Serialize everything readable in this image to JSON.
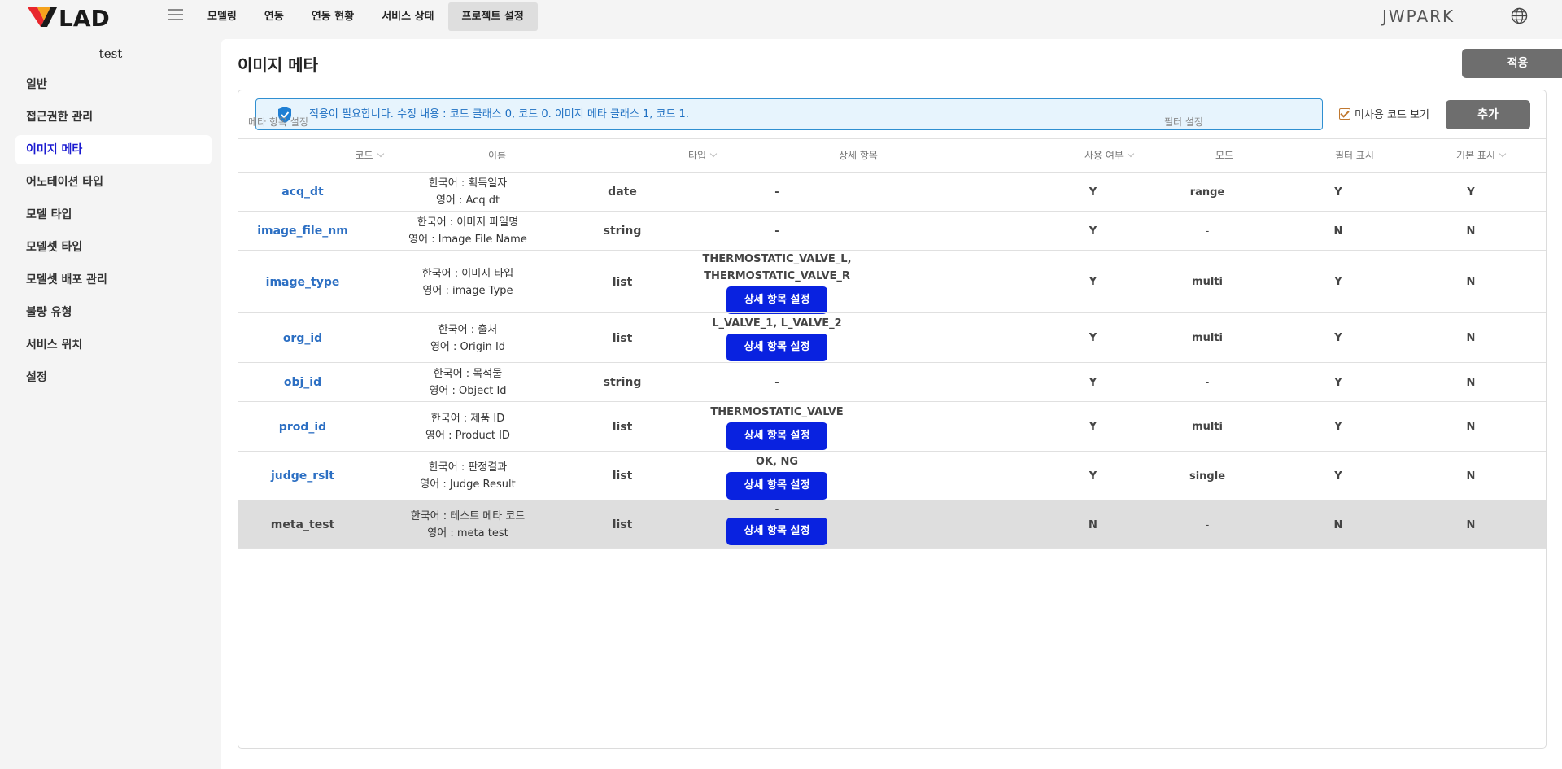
{
  "topbar": {
    "logo_text": "VLAD",
    "nav": [
      "모델링",
      "연동",
      "연동 현황",
      "서비스 상태",
      "프로젝트 설정"
    ],
    "active_nav": "프로젝트 설정",
    "user": "JWPARK"
  },
  "sidebar": {
    "project": "test",
    "items": [
      "일반",
      "접근권한 관리",
      "이미지 메타",
      "어노테이션 타입",
      "모델 타입",
      "모델셋 타입",
      "모델셋 배포 관리",
      "불량 유형",
      "서비스 위치",
      "설정"
    ],
    "active": "이미지 메타"
  },
  "page": {
    "title": "이미지 메타",
    "apply_label": "적용",
    "add_label": "추가",
    "notice": "적용이 필요합니다. 수정 내용 : 코드 클래스 0, 코드 0. 이미지 메타 클래스 1, 코드 1.",
    "unused_label": "미사용 코드 보기",
    "unused_checked": true
  },
  "table": {
    "group_meta": "메타 항목 설정",
    "group_filter": "필터 설정",
    "headers": {
      "code": "코드",
      "name": "이름",
      "type": "타입",
      "detail": "상세 항목",
      "use": "사용 여부",
      "mode": "모드",
      "filter_show": "필터 표시",
      "default_show": "기본 표시"
    },
    "detail_button_label": "상세 항목 설정",
    "rows": [
      {
        "code": "acq_dt",
        "name_ko": "한국어 : 획득일자",
        "name_en": "영어 : Acq dt",
        "type": "date",
        "detail": [
          "-"
        ],
        "has_button": false,
        "use": "Y",
        "mode": "range",
        "filter_show": "Y",
        "default_show": "Y",
        "disabled": false
      },
      {
        "code": "image_file_nm",
        "name_ko": "한국어 : 이미지 파일명",
        "name_en": "영어 : Image File Name",
        "type": "string",
        "detail": [
          "-"
        ],
        "has_button": false,
        "use": "Y",
        "mode": "-",
        "filter_show": "N",
        "default_show": "N",
        "disabled": false
      },
      {
        "code": "image_type",
        "name_ko": "한국어 : 이미지 타입",
        "name_en": "영어 : image Type",
        "type": "list",
        "detail": [
          "THERMOSTATIC_VALVE_L,",
          "THERMOSTATIC_VALVE_R"
        ],
        "has_button": true,
        "use": "Y",
        "mode": "multi",
        "filter_show": "Y",
        "default_show": "N",
        "disabled": false
      },
      {
        "code": "org_id",
        "name_ko": "한국어 : 출처",
        "name_en": "영어 : Origin Id",
        "type": "list",
        "detail": [
          "L_VALVE_1, L_VALVE_2"
        ],
        "has_button": true,
        "use": "Y",
        "mode": "multi",
        "filter_show": "Y",
        "default_show": "N",
        "disabled": false
      },
      {
        "code": "obj_id",
        "name_ko": "한국어 : 목적물",
        "name_en": "영어 : Object Id",
        "type": "string",
        "detail": [
          "-"
        ],
        "has_button": false,
        "use": "Y",
        "mode": "-",
        "filter_show": "Y",
        "default_show": "N",
        "disabled": false
      },
      {
        "code": "prod_id",
        "name_ko": "한국어 : 제품 ID",
        "name_en": "영어 : Product ID",
        "type": "list",
        "detail": [
          "THERMOSTATIC_VALVE"
        ],
        "has_button": true,
        "use": "Y",
        "mode": "multi",
        "filter_show": "Y",
        "default_show": "N",
        "disabled": false
      },
      {
        "code": "judge_rslt",
        "name_ko": "한국어 : 판정결과",
        "name_en": "영어 : Judge Result",
        "type": "list",
        "detail": [
          "OK, NG"
        ],
        "has_button": true,
        "use": "Y",
        "mode": "single",
        "filter_show": "Y",
        "default_show": "N",
        "disabled": false
      },
      {
        "code": "meta_test",
        "name_ko": "한국어 : 테스트 메타 코드",
        "name_en": "영어 : meta test",
        "type": "list",
        "detail": [
          "-"
        ],
        "has_button": true,
        "use": "N",
        "mode": "-",
        "filter_show": "N",
        "default_show": "N",
        "disabled": true
      }
    ]
  }
}
